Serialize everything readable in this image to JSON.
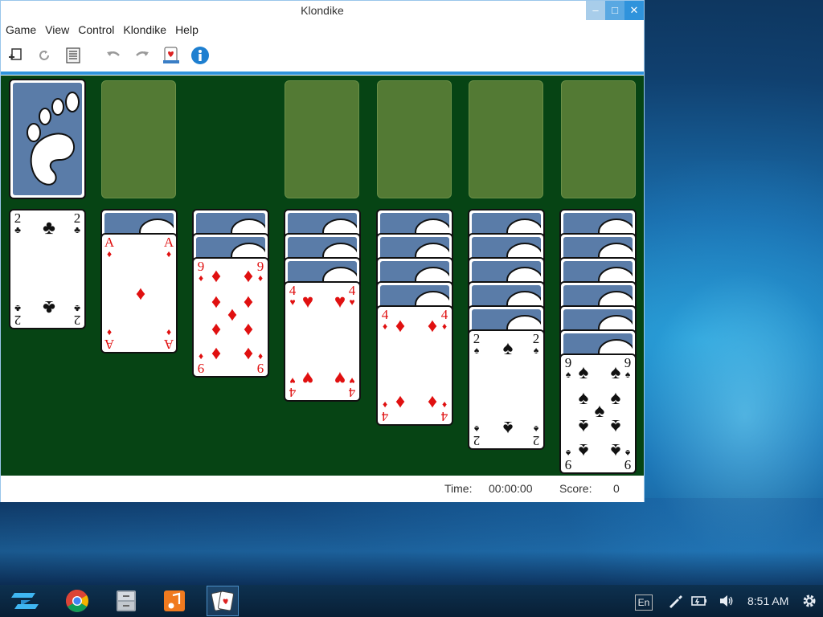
{
  "window": {
    "title": "Klondike",
    "controls": {
      "minimize": "–",
      "maximize": "□",
      "close": "✕"
    }
  },
  "menu": [
    "Game",
    "View",
    "Control",
    "Klondike",
    "Help"
  ],
  "toolbar": {
    "icons": [
      "new-game-icon",
      "restart-icon",
      "statistics-icon",
      "undo-icon",
      "redo-icon",
      "hint-icon",
      "about-icon"
    ]
  },
  "status": {
    "time_label": "Time:",
    "time_value": "00:00:00",
    "score_label": "Score:",
    "score_value": "0"
  },
  "colors": {
    "felt": "#064414",
    "empty_slot": "#537a34",
    "card_back": "#5a7ca8",
    "accent": "#2f93dc",
    "red_suit": "#e01010"
  },
  "tableau": [
    {
      "face_down": 0,
      "top": {
        "rank": "2",
        "suit": "♣",
        "color": "black"
      }
    },
    {
      "face_down": 1,
      "top": {
        "rank": "A",
        "suit": "♦",
        "color": "red"
      }
    },
    {
      "face_down": 2,
      "top": {
        "rank": "9",
        "suit": "♦",
        "color": "red"
      }
    },
    {
      "face_down": 3,
      "top": {
        "rank": "4",
        "suit": "♥",
        "color": "red"
      }
    },
    {
      "face_down": 4,
      "top": {
        "rank": "4",
        "suit": "♦",
        "color": "red"
      }
    },
    {
      "face_down": 5,
      "top": {
        "rank": "2",
        "suit": "♠",
        "color": "black"
      }
    },
    {
      "face_down": 6,
      "top": {
        "rank": "9",
        "suit": "♠",
        "color": "black"
      }
    }
  ],
  "taskbar": {
    "apps": [
      "chrome-icon",
      "file-manager-icon",
      "music-player-icon",
      "solitaire-icon"
    ],
    "language": "En",
    "clock": "8:51 AM"
  }
}
